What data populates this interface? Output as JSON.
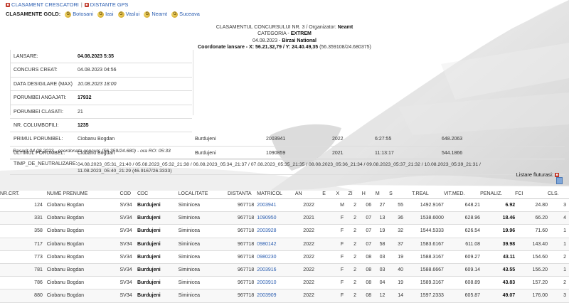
{
  "nav": {
    "links": [
      "CLASAMENT CRESCATORI",
      "DISTANTE GPS"
    ]
  },
  "gold": {
    "label": "CLASAMENTE GOLD:",
    "links": [
      "Botosani",
      "Iasi",
      "Vaslui",
      "Neamt",
      "Suceava"
    ],
    "badge_letter": "G"
  },
  "header": {
    "line1_prefix": "CLASAMENTUL CONCURSULUI NR. 3 / Organizator:",
    "line1_org": "Neamt",
    "line2_prefix": "CATEGORIA -",
    "line2_cat": "EXTREM",
    "line3_prefix": "04.08.2023 -",
    "line3_place": "Birzai National",
    "line4_label": "Coordonate lansare - X: 56.21.32,79 / Y: 24.40.49,35",
    "line4_extra": "(56.359108/24.680375)"
  },
  "info": [
    {
      "key": "LANSARE:",
      "value": "04.08.2023 5:35",
      "style": "bold"
    },
    {
      "key": "CONCURS CREAT:",
      "value": "04.08.2023 04:56",
      "style": "normal"
    },
    {
      "key": "DATA DESIGILARE (MAX)",
      "value": "10.08.2023 18:00",
      "style": "italic"
    },
    {
      "key": "PORUMBEI ANGAJATI:",
      "value": "17932",
      "style": "bold"
    },
    {
      "key": "PORUMBEI CLASATI:",
      "value": "21",
      "style": "normal"
    },
    {
      "key": "NR. COLUMBOFILI:",
      "value": "1235",
      "style": "bold"
    }
  ],
  "first_last": [
    {
      "key": "PRIMUL PORUMBEL:",
      "name": "Ciobanu Bogdan",
      "locality": "Burdujeni",
      "ring": "2003941",
      "year": "2022",
      "time": "6:27:55",
      "speed": "648.2063"
    },
    {
      "key": "ULTIMUL PORUMBEL:",
      "name": "Ciobanu Bogdan",
      "locality": "Burdujeni",
      "ring": "1090859",
      "year": "2021",
      "time": "11:13:17",
      "speed": "544.1866"
    }
  ],
  "rasarit": "Rasarit 04.08.2023 - coordonata concurs (56.359/24.680) - ora RO: 05:33",
  "timp": {
    "key": "TIMP_DE_NEUTRALIZARE:",
    "value": "04.08.2023_05:31_21:40 / 05.08.2023_05:32_21:38 / 06.08.2023_05:34_21:37 / 07.08.2023_05:35_21:35 / 08.08.2023_05:36_21:34 / 09.08.2023_05:37_21:32 / 10.08.2023_05:39_21:31 / 11.08.2023_05:40_21:29 (46.9167/26.3333)"
  },
  "listare": "Listare fluturasi:",
  "table": {
    "headers": [
      "NR.CRT.",
      "NUME PRENUME",
      "COD",
      "CDC",
      "LOCALITATE",
      "DISTANTA",
      "MATRICOL",
      "AN",
      "E",
      "X",
      "ZI",
      "H",
      "M",
      "S",
      "T.REAL",
      "VIT.MED.",
      "PENALIZ.",
      "FCI",
      "CLS."
    ],
    "rows": [
      [
        "124",
        "Ciobanu Bogdan",
        "SV34",
        "Burdujeni",
        "Siminicea",
        "967718",
        "2003941",
        "2022",
        "",
        "M",
        "2",
        "06",
        "27",
        "55",
        "1492.9167",
        "648.21",
        "6.92",
        "24.80",
        "3"
      ],
      [
        "331",
        "Ciobanu Bogdan",
        "SV34",
        "Burdujeni",
        "Siminicea",
        "967718",
        "1090950",
        "2021",
        "",
        "F",
        "2",
        "07",
        "13",
        "36",
        "1538.6000",
        "628.96",
        "18.46",
        "66.20",
        "4"
      ],
      [
        "358",
        "Ciobanu Bogdan",
        "SV34",
        "Burdujeni",
        "Siminicea",
        "967718",
        "2003928",
        "2022",
        "",
        "F",
        "2",
        "07",
        "19",
        "32",
        "1544.5333",
        "626.54",
        "19.96",
        "71.60",
        "1"
      ],
      [
        "717",
        "Ciobanu Bogdan",
        "SV34",
        "Burdujeni",
        "Siminicea",
        "967718",
        "0980142",
        "2022",
        "",
        "F",
        "2",
        "07",
        "58",
        "37",
        "1583.6167",
        "611.08",
        "39.98",
        "143.40",
        "1"
      ],
      [
        "773",
        "Ciobanu Bogdan",
        "SV34",
        "Burdujeni",
        "Siminicea",
        "967718",
        "0980230",
        "2022",
        "",
        "F",
        "2",
        "08",
        "03",
        "19",
        "1588.3167",
        "609.27",
        "43.11",
        "154.60",
        "2"
      ],
      [
        "781",
        "Ciobanu Bogdan",
        "SV34",
        "Burdujeni",
        "Siminicea",
        "967718",
        "2003916",
        "2022",
        "",
        "F",
        "2",
        "08",
        "03",
        "40",
        "1588.6667",
        "609.14",
        "43.55",
        "156.20",
        "1"
      ],
      [
        "786",
        "Ciobanu Bogdan",
        "SV34",
        "Burdujeni",
        "Siminicea",
        "967718",
        "2003910",
        "2022",
        "",
        "F",
        "2",
        "08",
        "04",
        "19",
        "1589.3167",
        "608.89",
        "43.83",
        "157.20",
        "2"
      ],
      [
        "880",
        "Ciobanu Bogdan",
        "SV34",
        "Burdujeni",
        "Siminicea",
        "967718",
        "2003909",
        "2022",
        "",
        "F",
        "2",
        "08",
        "12",
        "14",
        "1597.2333",
        "605.87",
        "49.07",
        "176.00",
        "3"
      ]
    ]
  },
  "colors": {
    "link": "#2a5db0",
    "badge_red": "#c0392b",
    "gold": "#d4a62a"
  }
}
